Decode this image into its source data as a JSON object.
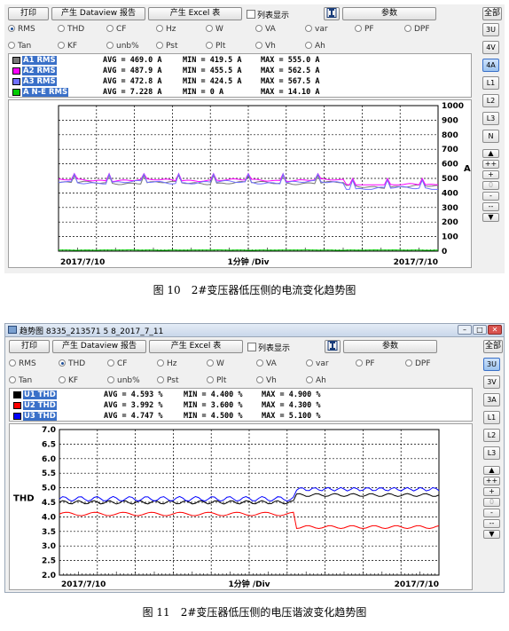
{
  "toolbar": {
    "print": "打印",
    "dataview": "产生 Dataview 报告",
    "excel": "产生 Excel 表",
    "list": "列表显示",
    "params": "参数",
    "all": "全部"
  },
  "window2": {
    "title": "趋势图 8335_213571 5 8_2017_7_11"
  },
  "radio_row1": [
    "RMS",
    "THD",
    "CF",
    "Hz",
    "W",
    "VA",
    "var",
    "PF",
    "DPF"
  ],
  "radio_row2": [
    "Tan",
    "KF",
    "unb%",
    "Pst",
    "Plt",
    "Vh",
    "Ah"
  ],
  "sidebar1": [
    "3U",
    "4V",
    "4A",
    "L1",
    "L2",
    "L3",
    "N"
  ],
  "sidebar2": [
    "3U",
    "3V",
    "3A",
    "L1",
    "L2",
    "L3"
  ],
  "stepper": {
    "up": "▲",
    "plus2": "++",
    "plus": "+",
    "zero": "0",
    "minus": "-",
    "minus2": "--",
    "down": "▼"
  },
  "stats1": [
    {
      "label": "A1 RMS",
      "avg": "AVG = 469.0 A",
      "min": "MIN = 419.5 A",
      "max": "MAX = 555.0 A",
      "color": "#777777"
    },
    {
      "label": "A2 RMS",
      "avg": "AVG = 487.9 A",
      "min": "MIN = 455.5 A",
      "max": "MAX = 562.5 A",
      "color": "#ff00ff"
    },
    {
      "label": "A3 RMS",
      "avg": "AVG = 472.8 A",
      "min": "MIN = 424.5 A",
      "max": "MAX = 567.5 A",
      "color": "#7070ff"
    },
    {
      "label": "A N-E RMS",
      "avg": "AVG = 7.228 A",
      "min": "MIN = 0 A",
      "max": "MAX = 14.10 A",
      "color": "#00cc00"
    }
  ],
  "stats2": [
    {
      "label": "U1 THD",
      "avg": "AVG = 4.593 %",
      "min": "MIN = 4.400 %",
      "max": "MAX = 4.900 %",
      "color": "#000000"
    },
    {
      "label": "U2 THD",
      "avg": "AVG = 3.992 %",
      "min": "MIN = 3.600 %",
      "max": "MAX = 4.300 %",
      "color": "#ff0000"
    },
    {
      "label": "U3 THD",
      "avg": "AVG = 4.747 %",
      "min": "MIN = 4.500 %",
      "max": "MAX = 5.100 %",
      "color": "#0000ff"
    }
  ],
  "chart_data": [
    {
      "type": "line",
      "title": "",
      "ylabel": "A",
      "xlabel_left": "2017/7/10",
      "xlabel_center": "1分钟 /Div",
      "xlabel_right": "2017/7/10",
      "ylim": [
        0,
        1000
      ],
      "yticks": [
        "0",
        "100",
        "200",
        "300",
        "400",
        "500",
        "600",
        "700",
        "800",
        "900",
        "1000"
      ],
      "series": [
        {
          "name": "A1 RMS",
          "color": "#777777",
          "min": 419.5,
          "avg": 469.0,
          "max": 555.0
        },
        {
          "name": "A2 RMS",
          "color": "#ff00ff",
          "min": 455.5,
          "avg": 487.9,
          "max": 562.5
        },
        {
          "name": "A3 RMS",
          "color": "#7070ff",
          "min": 424.5,
          "avg": 472.8,
          "max": 567.5
        },
        {
          "name": "A N-E RMS",
          "color": "#00cc00",
          "min": 0,
          "avg": 7.228,
          "max": 14.1
        }
      ]
    },
    {
      "type": "line",
      "title": "",
      "ylabel": "THD",
      "xlabel_left": "2017/7/10",
      "xlabel_center": "1分钟 /Div",
      "xlabel_right": "2017/7/10",
      "ylim": [
        2.0,
        7.0
      ],
      "yticks": [
        "2.0",
        "2.5",
        "3.0",
        "3.5",
        "4.0",
        "4.5",
        "5.0",
        "5.5",
        "6.0",
        "6.5",
        "7.0"
      ],
      "series": [
        {
          "name": "U1 THD",
          "color": "#000000",
          "min": 4.4,
          "avg": 4.593,
          "max": 4.9
        },
        {
          "name": "U2 THD",
          "color": "#ff0000",
          "min": 3.6,
          "avg": 3.992,
          "max": 4.3
        },
        {
          "name": "U3 THD",
          "color": "#0000ff",
          "min": 4.5,
          "avg": 4.747,
          "max": 5.1
        }
      ]
    }
  ],
  "captions": {
    "fig10": "图 10　2#变压器低压侧的电流变化趋势图",
    "fig11": "图 11　2#变压器低压侧的电压谐波变化趋势图"
  }
}
